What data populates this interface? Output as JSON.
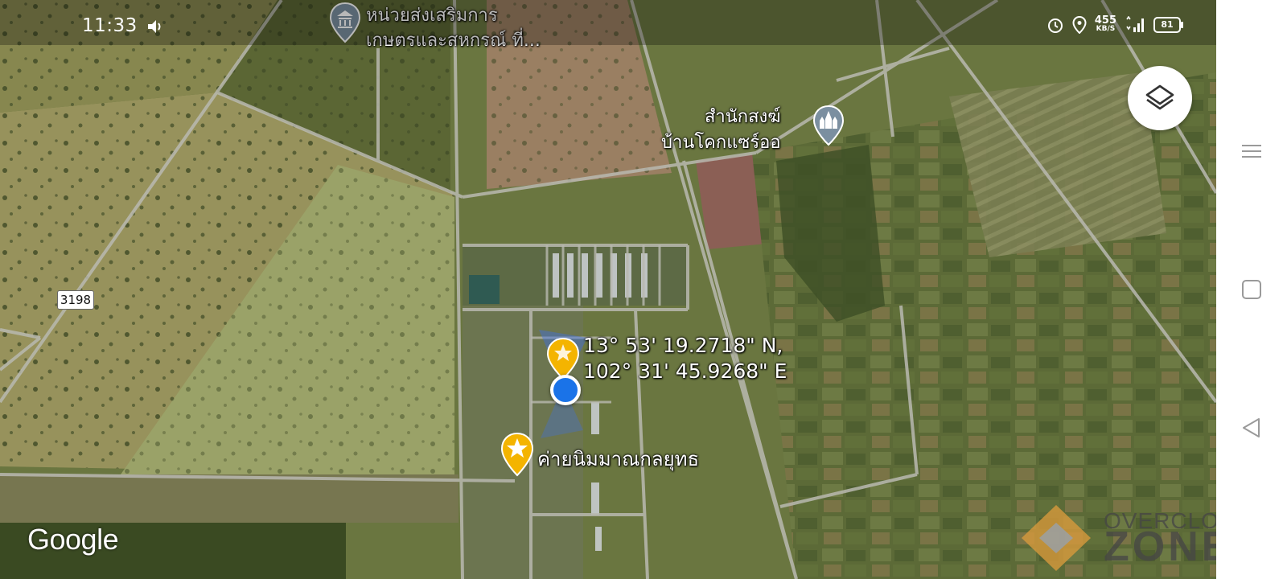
{
  "status_bar": {
    "time": "11:33",
    "speed_value": "455",
    "speed_unit": "KB/S",
    "network": "H+",
    "battery": "81"
  },
  "map": {
    "poi_top_line1": "หน่วยส่งเสริมการ",
    "poi_top_line2": "เกษตรและสหกรณ์ ที่...",
    "poi_right_line1": "สำนักสงฆ์",
    "poi_right_line2": "บ้านโคกแซร์ออ",
    "coords_line1": "13° 53' 19.2718\" N,",
    "coords_line2": "102° 31' 45.9268\" E",
    "camp_label": "ค่ายนิมมาณกลยุทธ",
    "road_number": "3198",
    "google_logo": "Google"
  },
  "watermark": {
    "line1": "OVERCLOCK",
    "line2": "ZONE"
  },
  "colors": {
    "pin_yellow": "#f4b400",
    "location_blue": "#1a73e8",
    "poi_gray": "#7b8fa0"
  },
  "icons": {
    "layers": "layers-icon",
    "volume": "volume-icon",
    "alarm": "alarm-icon",
    "location": "location-pin-icon",
    "signal": "signal-icon",
    "battery": "battery-icon",
    "menu": "menu-icon",
    "home": "home-square-icon",
    "back": "back-triangle-icon"
  }
}
